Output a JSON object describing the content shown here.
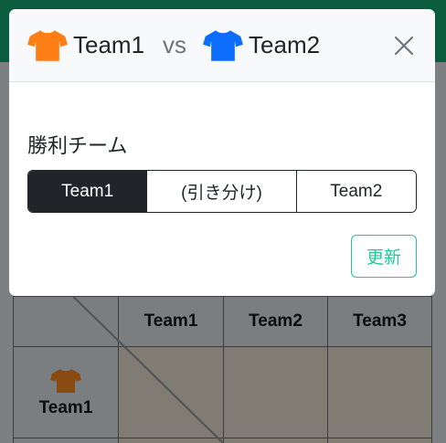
{
  "modal": {
    "team_home": {
      "name": "Team1",
      "shirt_color": "#fd7e14"
    },
    "vs_text": "vs",
    "team_away": {
      "name": "Team2",
      "shirt_color": "#0d6efd"
    },
    "winner_label": "勝利チーム",
    "options": [
      "Team1",
      "(引き分け)",
      "Team2"
    ],
    "selected_option": "Team1",
    "update_label": "更新",
    "accent_color": "#20c997"
  },
  "background": {
    "header_color": "#0c5c3f",
    "table": {
      "column_headers": [
        "Team1",
        "Team2",
        "Team3"
      ],
      "row_headers": [
        {
          "name": "Team1",
          "shirt_color": "#8a4b12"
        }
      ]
    }
  }
}
